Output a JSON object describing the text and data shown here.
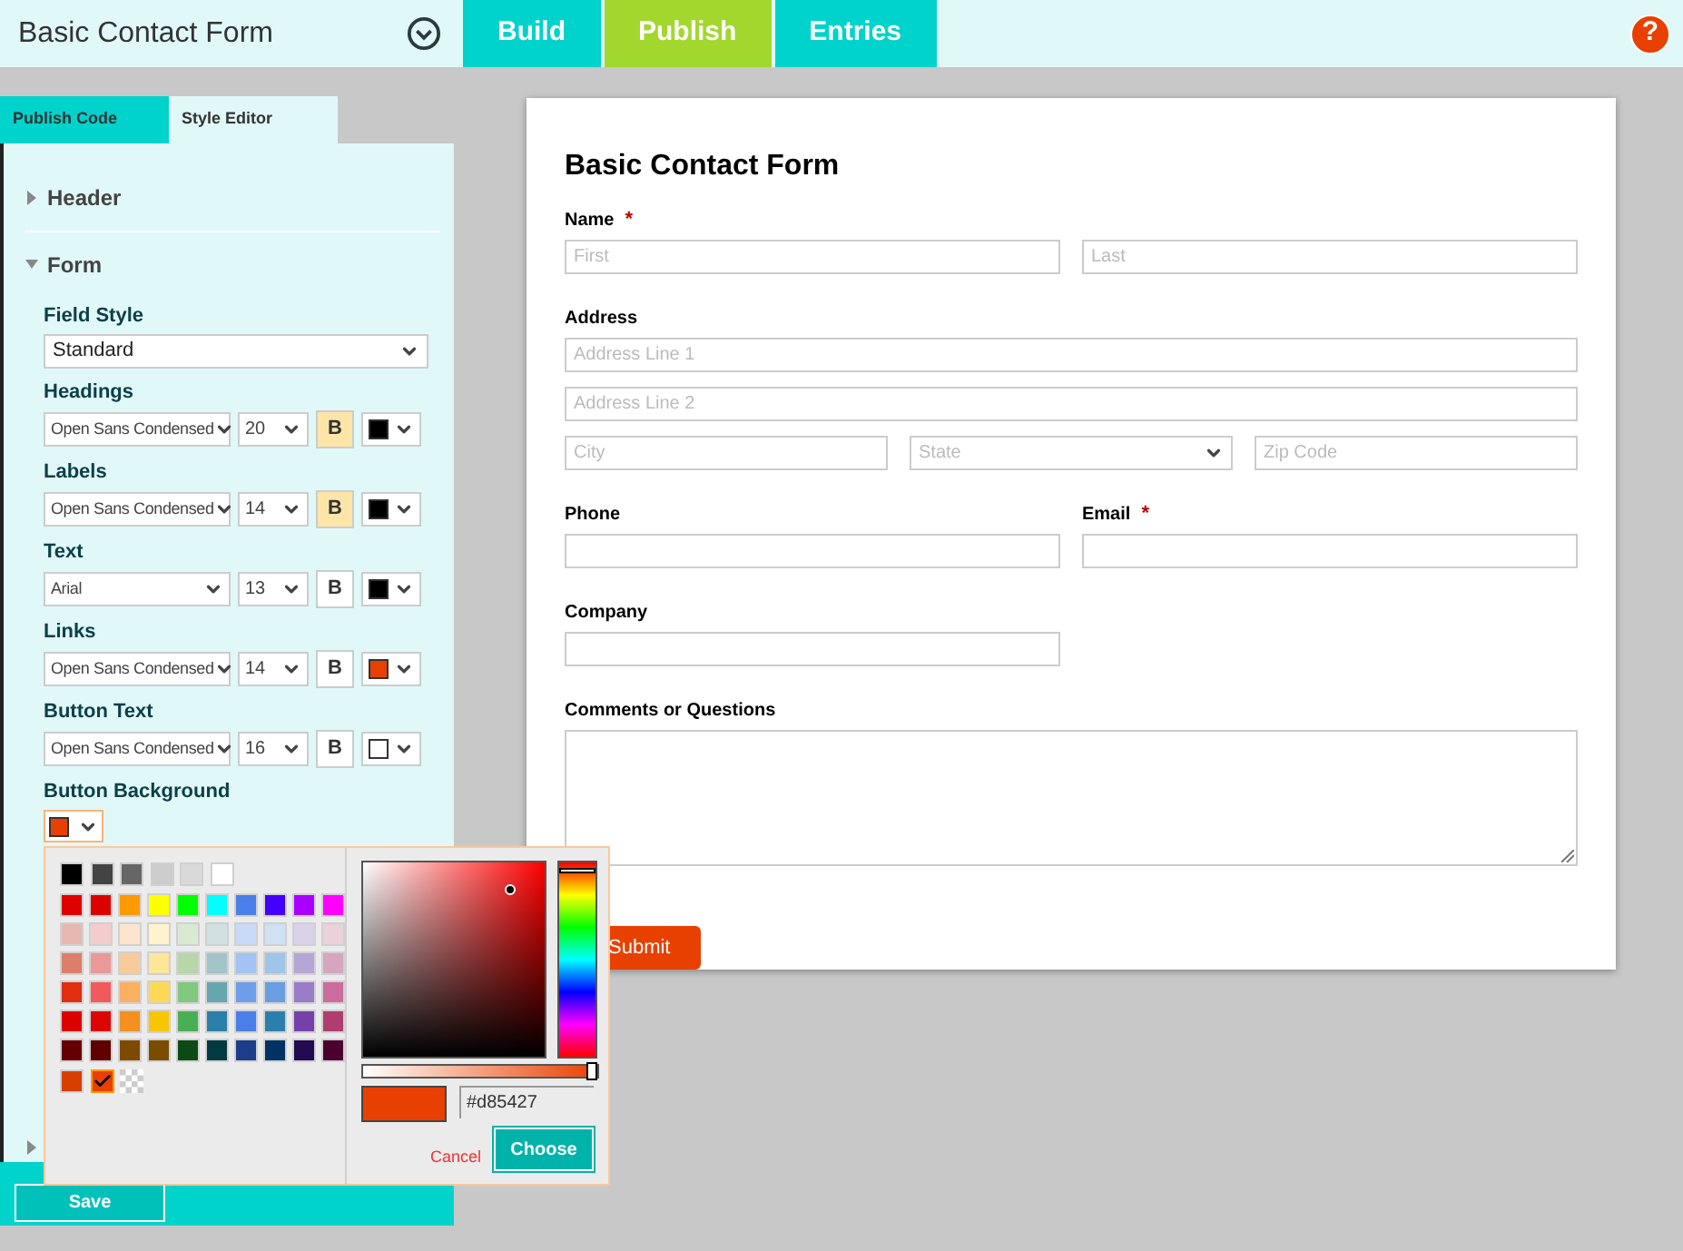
{
  "app_bar": {
    "title": "Basic Contact Form",
    "tabs": [
      {
        "label": "Build",
        "selected": false
      },
      {
        "label": "Publish",
        "selected": true
      },
      {
        "label": "Entries",
        "selected": false
      }
    ],
    "help": "?"
  },
  "sidebar": {
    "tabs": [
      {
        "label": "Publish Code",
        "selected": false
      },
      {
        "label": "Style Editor",
        "selected": true
      }
    ],
    "sections": [
      {
        "title": "Header",
        "expanded": false
      },
      {
        "title": "Form",
        "expanded": true,
        "rows": [
          {
            "kind": "select",
            "label": "Field Style",
            "value": "Standard"
          },
          {
            "kind": "font",
            "label": "Headings",
            "font": "Open Sans Condensed",
            "size": "20",
            "bold_label": "B",
            "bold": true,
            "color": "#000000"
          },
          {
            "kind": "font",
            "label": "Labels",
            "font": "Open Sans Condensed",
            "size": "14",
            "bold_label": "B",
            "bold": true,
            "color": "#000000"
          },
          {
            "kind": "font",
            "label": "Text",
            "font": "Arial",
            "size": "13",
            "bold_label": "B",
            "bold": false,
            "color": "#000000"
          },
          {
            "kind": "font",
            "label": "Links",
            "font": "Open Sans Condensed",
            "size": "14",
            "bold_label": "B",
            "bold": false,
            "color": "#e84000"
          },
          {
            "kind": "font",
            "label": "Button Text",
            "font": "Open Sans Condensed",
            "size": "16",
            "bold_label": "B",
            "bold": false,
            "color": "#ffffff"
          },
          {
            "kind": "color",
            "label": "Button Background",
            "color": "#e84000"
          }
        ]
      },
      {
        "expanded": false
      }
    ],
    "save": "Save"
  },
  "color_picker": {
    "palette": [
      [
        {
          "color": "#000000",
          "selected": false
        },
        {
          "color": "#434343",
          "selected": false
        },
        {
          "color": "#666666",
          "selected": false
        },
        {
          "color": "#cccccc",
          "selected": false
        },
        {
          "color": "#d9d9d9",
          "selected": false
        },
        {
          "color": "#ffffff",
          "selected": false
        }
      ],
      [
        {
          "color": "#e00000",
          "selected": false
        },
        {
          "color": "#dd0000",
          "selected": false
        },
        {
          "color": "#ff9900",
          "selected": false
        },
        {
          "color": "#ffff00",
          "selected": false
        },
        {
          "color": "#00ff00",
          "selected": false
        },
        {
          "color": "#00ffff",
          "selected": false
        },
        {
          "color": "#4a7ee8",
          "selected": false
        },
        {
          "color": "#4400ff",
          "selected": false
        },
        {
          "color": "#aa00ff",
          "selected": false
        },
        {
          "color": "#ff00ff",
          "selected": false
        }
      ],
      [
        {
          "color": "#e6b8af",
          "selected": false
        },
        {
          "color": "#f4cccc",
          "selected": false
        },
        {
          "color": "#fce5cd",
          "selected": false
        },
        {
          "color": "#fff2cc",
          "selected": false
        },
        {
          "color": "#d9ead3",
          "selected": false
        },
        {
          "color": "#d0e0e3",
          "selected": false
        },
        {
          "color": "#c9daf8",
          "selected": false
        },
        {
          "color": "#cfe2f3",
          "selected": false
        },
        {
          "color": "#d9d2e9",
          "selected": false
        },
        {
          "color": "#ead1dc",
          "selected": false
        }
      ],
      [
        {
          "color": "#dd7e6b",
          "selected": false
        },
        {
          "color": "#ea9999",
          "selected": false
        },
        {
          "color": "#f9cb9c",
          "selected": false
        },
        {
          "color": "#ffe599",
          "selected": false
        },
        {
          "color": "#b6d7a8",
          "selected": false
        },
        {
          "color": "#a2c4c9",
          "selected": false
        },
        {
          "color": "#a4c2f4",
          "selected": false
        },
        {
          "color": "#9fc5e8",
          "selected": false
        },
        {
          "color": "#b4a7d6",
          "selected": false
        },
        {
          "color": "#d5a6bd",
          "selected": false
        }
      ],
      [
        {
          "color": "#e02e10",
          "selected": false
        },
        {
          "color": "#f05a5a",
          "selected": false
        },
        {
          "color": "#fdb05f",
          "selected": false
        },
        {
          "color": "#ffd955",
          "selected": false
        },
        {
          "color": "#80c97e",
          "selected": false
        },
        {
          "color": "#66a6ae",
          "selected": false
        },
        {
          "color": "#6d9eeb",
          "selected": false
        },
        {
          "color": "#6a9ee3",
          "selected": false
        },
        {
          "color": "#9a7bc8",
          "selected": false
        },
        {
          "color": "#cd6d9d",
          "selected": false
        }
      ],
      [
        {
          "color": "#dd0000",
          "selected": false
        },
        {
          "color": "#dd0404",
          "selected": false
        },
        {
          "color": "#f49020",
          "selected": false
        },
        {
          "color": "#f8c600",
          "selected": false
        },
        {
          "color": "#4aaf54",
          "selected": false
        },
        {
          "color": "#2b7fa8",
          "selected": false
        },
        {
          "color": "#4a7ee8",
          "selected": false
        },
        {
          "color": "#2c7fad",
          "selected": false
        },
        {
          "color": "#7540a8",
          "selected": false
        },
        {
          "color": "#b03c70",
          "selected": false
        }
      ],
      [
        {
          "color": "#660000",
          "selected": false
        },
        {
          "color": "#5e0000",
          "selected": false
        },
        {
          "color": "#7c4a00",
          "selected": false
        },
        {
          "color": "#7a4c00",
          "selected": false
        },
        {
          "color": "#0c4a14",
          "selected": false
        },
        {
          "color": "#013a40",
          "selected": false
        },
        {
          "color": "#1c3d8a",
          "selected": false
        },
        {
          "color": "#003364",
          "selected": false
        },
        {
          "color": "#240a50",
          "selected": false
        },
        {
          "color": "#4c0030",
          "selected": false
        }
      ]
    ],
    "recent": [
      {
        "kind": "color",
        "color": "#d63f00",
        "selected": false
      },
      {
        "kind": "color",
        "color": "#e84000",
        "selected": true
      },
      {
        "kind": "transparent",
        "selected": false
      }
    ],
    "hue": {
      "level": 0.03
    },
    "alpha": {
      "level": 1
    },
    "preview": {
      "color": "#e84000"
    },
    "hex_value": "#d85427",
    "cancel": "Cancel",
    "choose": "Choose"
  },
  "form": {
    "title": "Basic Contact Form",
    "rows": [
      {
        "kind": "full",
        "groups": [
          {
            "label": "Name",
            "required": true,
            "required_mark": "*",
            "lines": [
              [
                {
                  "kind": "text",
                  "placeholder": "First"
                },
                {
                  "kind": "text",
                  "placeholder": "Last"
                }
              ]
            ]
          }
        ]
      },
      {
        "kind": "full",
        "groups": [
          {
            "label": "Address",
            "required": false,
            "lines": [
              [
                {
                  "kind": "text",
                  "placeholder": "Address Line 1"
                }
              ],
              [
                {
                  "kind": "text",
                  "placeholder": "Address Line 2"
                }
              ],
              [
                {
                  "kind": "text",
                  "placeholder": "City"
                },
                {
                  "kind": "select",
                  "placeholder": "State"
                },
                {
                  "kind": "text",
                  "placeholder": "Zip Code"
                }
              ]
            ]
          }
        ]
      },
      {
        "kind": "half",
        "groups": [
          {
            "label": "Phone",
            "required": false,
            "lines": [
              [
                {
                  "kind": "text"
                }
              ]
            ]
          },
          {
            "label": "Email",
            "required": true,
            "required_mark": "*",
            "lines": [
              [
                {
                  "kind": "text"
                }
              ]
            ]
          }
        ]
      },
      {
        "kind": "half",
        "groups": [
          {
            "label": "Company",
            "required": false,
            "lines": [
              [
                {
                  "kind": "text"
                }
              ]
            ]
          }
        ]
      },
      {
        "kind": "full",
        "groups": [
          {
            "label": "Comments or Questions",
            "required": false,
            "lines": [
              [
                {
                  "kind": "textarea"
                }
              ]
            ]
          }
        ]
      }
    ],
    "submit": "Submit"
  }
}
